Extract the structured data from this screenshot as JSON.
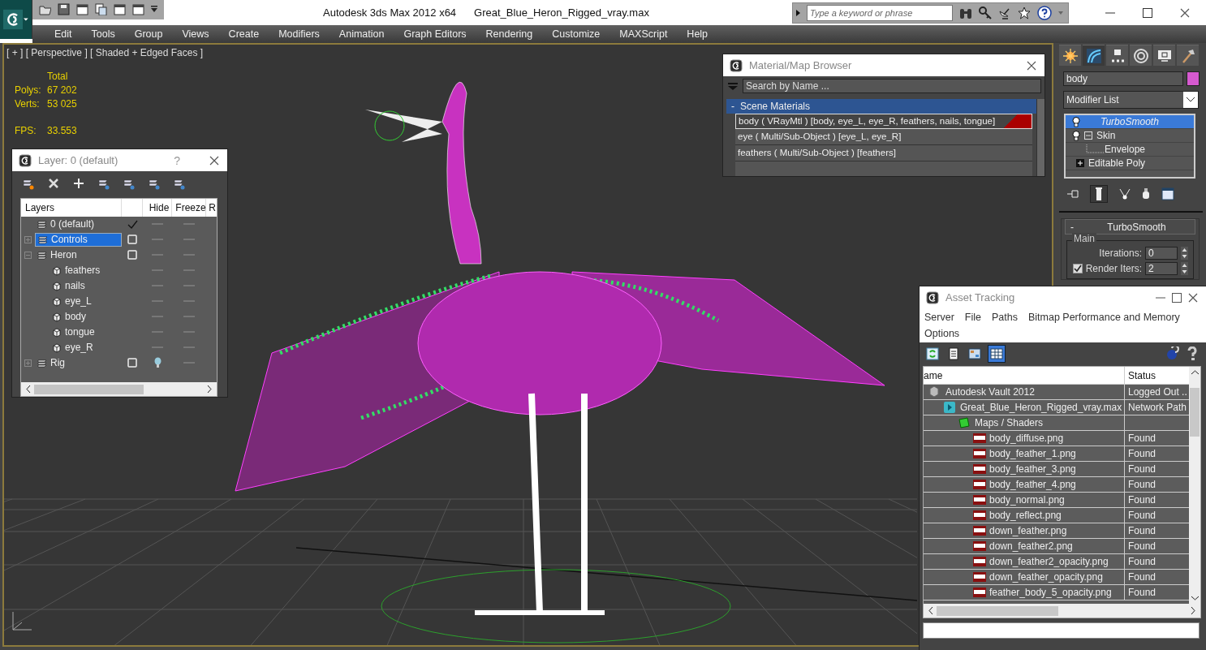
{
  "window": {
    "title": "Autodesk 3ds Max  2012 x64",
    "file": "Great_Blue_Heron_Rigged_vray.max"
  },
  "infocenter": {
    "placeholder": "Type a keyword or phrase"
  },
  "menu": [
    "Edit",
    "Tools",
    "Group",
    "Views",
    "Create",
    "Modifiers",
    "Animation",
    "Graph Editors",
    "Rendering",
    "Customize",
    "MAXScript",
    "Help"
  ],
  "viewport": {
    "label": "[ + ] [ Perspective ] [ Shaded + Edged Faces ]",
    "stats": {
      "header": "Total",
      "rows": [
        {
          "label": "Polys:",
          "value": "67 202"
        },
        {
          "label": "Verts:",
          "value": "53 025"
        },
        {
          "label": "FPS:",
          "value": "33.553"
        }
      ]
    }
  },
  "layer_window": {
    "title": "Layer: 0 (default)",
    "help": "?",
    "columns": [
      "Layers",
      "",
      "Hide",
      "Freeze",
      "R"
    ],
    "layers": [
      {
        "name": "0 (default)",
        "kind": "layer",
        "current": true,
        "selected": false,
        "hidden": false
      },
      {
        "name": "Controls",
        "kind": "layer",
        "current": false,
        "selected": true,
        "expanded": false,
        "hidden": false
      },
      {
        "name": "Heron",
        "kind": "layer",
        "current": false,
        "selected": false,
        "expanded": true,
        "hidden": false,
        "children": [
          {
            "name": "feathers",
            "kind": "object",
            "hidden": false
          },
          {
            "name": "nails",
            "kind": "object",
            "hidden": false
          },
          {
            "name": "eye_L",
            "kind": "object",
            "hidden": false
          },
          {
            "name": "body",
            "kind": "object",
            "hidden": false
          },
          {
            "name": "tongue",
            "kind": "object",
            "hidden": false
          },
          {
            "name": "eye_R",
            "kind": "object",
            "hidden": false
          }
        ]
      },
      {
        "name": "Rig",
        "kind": "layer",
        "current": false,
        "selected": false,
        "expanded": false,
        "hidden": true
      }
    ]
  },
  "material_browser": {
    "title": "Material/Map Browser",
    "search": {
      "placeholder": "Search by Name ..."
    },
    "group": {
      "toggle": "-",
      "label": "Scene Materials"
    },
    "materials": [
      {
        "name": "body",
        "type": "( VRayMtl )",
        "objects": "[body, eye_L, eye_R, feathers, nails, tongue]",
        "selected": true
      },
      {
        "name": "eye",
        "type": "( Multi/Sub-Object )",
        "objects": "[eye_L, eye_R]",
        "selected": false
      },
      {
        "name": "feathers",
        "type": "( Multi/Sub-Object )",
        "objects": "[feathers]",
        "selected": false
      }
    ]
  },
  "command_panel": {
    "tabs": [
      {
        "kind": "create",
        "selected": false
      },
      {
        "kind": "modify",
        "selected": true
      },
      {
        "kind": "hierarchy",
        "selected": false
      },
      {
        "kind": "motion",
        "selected": false
      },
      {
        "kind": "display",
        "selected": false
      },
      {
        "kind": "utilities",
        "selected": false
      }
    ],
    "object_name": "body",
    "modifier_list": "Modifier List",
    "stack": [
      {
        "name": "TurboSmooth",
        "selected": true,
        "bulb": true
      },
      {
        "name": "Skin",
        "selected": false,
        "bulb": true,
        "expanded": true,
        "children": [
          {
            "name": "Envelope",
            "selected": false
          }
        ]
      },
      {
        "name": "Editable Poly",
        "selected": false,
        "bulb": false,
        "expanded": false
      }
    ],
    "rollout": {
      "title": "TurboSmooth",
      "toggle": "-",
      "group": "Main",
      "fields": [
        {
          "kind": "spinner",
          "label": "Iterations:",
          "value": "0"
        },
        {
          "kind": "checked_spinner",
          "label": "Render Iters:",
          "value": "2",
          "checked": true
        }
      ]
    }
  },
  "asset_tracking": {
    "title": "Asset Tracking",
    "menu": [
      "Server",
      "File",
      "Paths",
      "Bitmap Performance and Memory",
      "Options"
    ],
    "toolbar": [
      {
        "kind": "refresh",
        "selected": false
      },
      {
        "kind": "list",
        "selected": false
      },
      {
        "kind": "thumbnails",
        "selected": false
      },
      {
        "kind": "table",
        "selected": true
      }
    ],
    "columns": [
      "ame",
      "Status"
    ],
    "rows": [
      {
        "kind": "vault",
        "name": "Autodesk Vault 2012",
        "status": "Logged Out ..",
        "children": [
          {
            "kind": "max",
            "name": "Great_Blue_Heron_Rigged_vray.max",
            "status": "Network Path",
            "children": [
              {
                "kind": "folder",
                "name": "Maps / Shaders",
                "children": [
                  {
                    "kind": "png",
                    "name": "body_diffuse.png",
                    "status": "Found"
                  },
                  {
                    "kind": "png",
                    "name": "body_feather_1.png",
                    "status": "Found"
                  },
                  {
                    "kind": "png",
                    "name": "body_feather_3.png",
                    "status": "Found"
                  },
                  {
                    "kind": "png",
                    "name": "body_feather_4.png",
                    "status": "Found"
                  },
                  {
                    "kind": "png",
                    "name": "body_normal.png",
                    "status": "Found"
                  },
                  {
                    "kind": "png",
                    "name": "body_reflect.png",
                    "status": "Found"
                  },
                  {
                    "kind": "png",
                    "name": "down_feather.png",
                    "status": "Found"
                  },
                  {
                    "kind": "png",
                    "name": "down_feather2.png",
                    "status": "Found"
                  },
                  {
                    "kind": "png",
                    "name": "down_feather2_opacity.png",
                    "status": "Found"
                  },
                  {
                    "kind": "png",
                    "name": "down_feather_opacity.png",
                    "status": "Found"
                  },
                  {
                    "kind": "png",
                    "name": "feather_body_5_opacity.png",
                    "status": "Found"
                  }
                ]
              }
            ]
          }
        ]
      }
    ]
  }
}
